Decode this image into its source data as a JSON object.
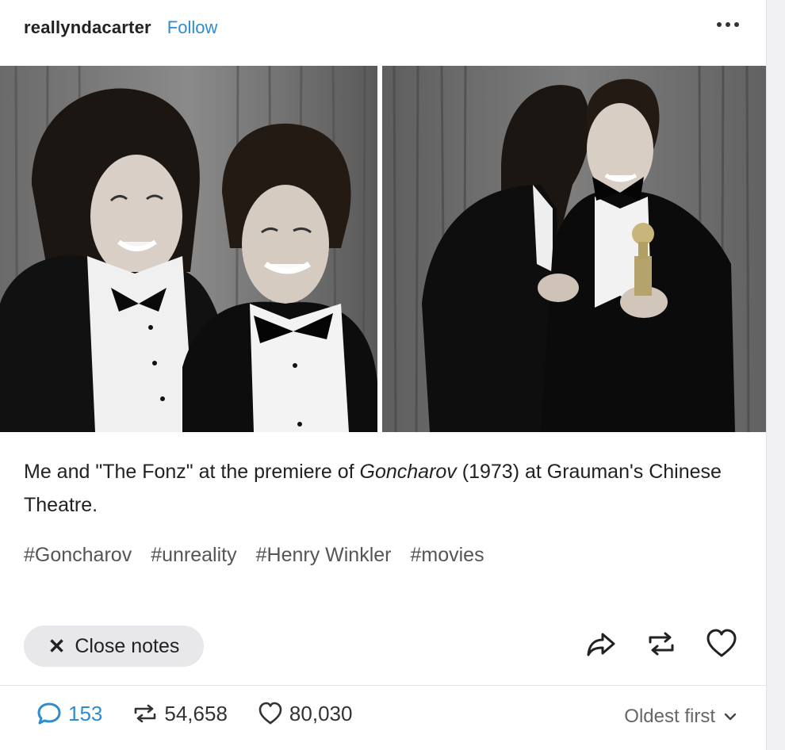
{
  "post": {
    "username": "reallyndacarter",
    "follow_label": "Follow",
    "caption": {
      "before": "Me and \"The Fonz\" at the premiere of ",
      "italic": "Goncharov",
      "after": " (1973) at Grauman's Chinese Theatre."
    },
    "tags": [
      "#Goncharov",
      "#unreality",
      "#Henry Winkler",
      "#movies"
    ]
  },
  "notes": {
    "close_label": "Close notes",
    "replies": "153",
    "reblogs": "54,658",
    "likes": "80,030",
    "sort_label": "Oldest first"
  },
  "icons": {
    "more": "more-options-icon",
    "share": "share-icon",
    "reblog": "reblog-icon",
    "like": "heart-icon",
    "reply": "reply-bubble-icon",
    "sort": "chevron-down-icon",
    "close": "close-icon"
  },
  "colors": {
    "accent": "#2e8ccf",
    "text": "#222222",
    "tag": "#555555",
    "pill": "#e8e8ea"
  }
}
